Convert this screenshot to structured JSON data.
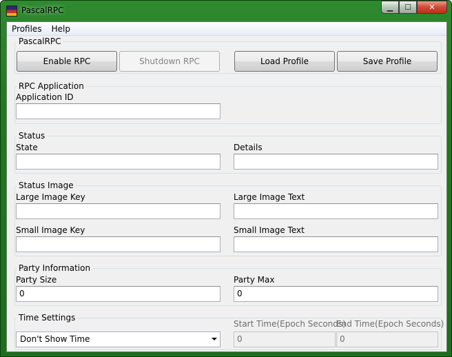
{
  "window": {
    "title": "PascalRPC"
  },
  "menu": {
    "items": [
      "Profiles",
      "Help"
    ]
  },
  "controls": {
    "group_label": "PascalRPC",
    "enable": "Enable RPC",
    "shutdown": "Shutdown RPC",
    "load": "Load Profile",
    "save": "Save Profile"
  },
  "application": {
    "group_label": "RPC Application",
    "id_label": "Application ID",
    "id_value": ""
  },
  "status": {
    "group_label": "Status",
    "state_label": "State",
    "state_value": "",
    "details_label": "Details",
    "details_value": ""
  },
  "image": {
    "group_label": "Status Image",
    "large_key_label": "Large Image Key",
    "large_key_value": "",
    "large_text_label": "Large Image Text",
    "large_text_value": "",
    "small_key_label": "Small Image Key",
    "small_key_value": "",
    "small_text_label": "Small Image Text",
    "small_text_value": ""
  },
  "party": {
    "group_label": "Party Information",
    "size_label": "Party Size",
    "size_value": "0",
    "max_label": "Party Max",
    "max_value": "0"
  },
  "time": {
    "group_label": "Time Settings",
    "mode_value": "Don't Show Time",
    "start_label": "Start Time(Epoch Seconds)",
    "start_value": "0",
    "end_label": "End Time(Epoch Seconds)",
    "end_value": "0"
  }
}
